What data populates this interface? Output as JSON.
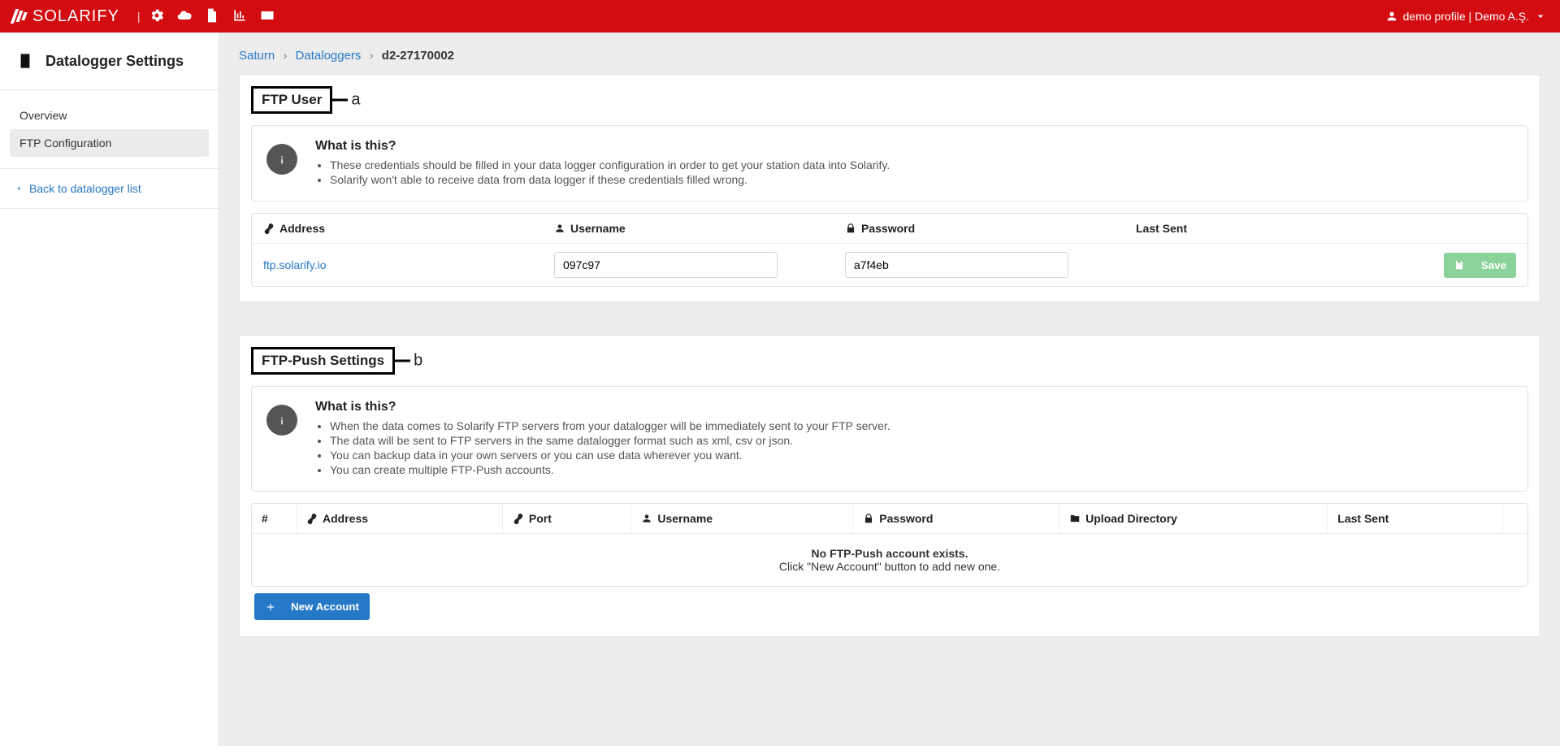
{
  "topbar": {
    "brand": "SOLARIFY",
    "profile": "demo profile | Demo A.Ş."
  },
  "sidebar": {
    "title": "Datalogger Settings",
    "items": [
      {
        "label": "Overview"
      },
      {
        "label": "FTP Configuration"
      }
    ],
    "back": "Back to datalogger list"
  },
  "breadcrumb": {
    "a": "Saturn",
    "b": "Dataloggers",
    "cur": "d2-27170002"
  },
  "ftp_user": {
    "title": "FTP User",
    "annot": "a",
    "info_title": "What is this?",
    "info_bullets": [
      "These credentials should be filled in your data logger configuration in order to get your station data into Solarify.",
      "Solarify won't able to receive data from data logger if these credentials filled wrong."
    ],
    "cols": {
      "address": "Address",
      "username": "Username",
      "password": "Password",
      "last": "Last Sent"
    },
    "row": {
      "address": "ftp.solarify.io",
      "username": "097c97",
      "password": "a7f4eb",
      "last": ""
    },
    "save": "Save"
  },
  "ftp_push": {
    "title": "FTP-Push Settings",
    "annot": "b",
    "info_title": "What is this?",
    "info_bullets": [
      "When the data comes to Solarify FTP servers from your datalogger will be immediately sent to your FTP server.",
      "The data will be sent to FTP servers in the same datalogger format such as xml, csv or json.",
      "You can backup data in your own servers or you can use data wherever you want.",
      "You can create multiple FTP-Push accounts."
    ],
    "cols": {
      "n": "#",
      "address": "Address",
      "port": "Port",
      "username": "Username",
      "password": "Password",
      "dir": "Upload Directory",
      "last": "Last Sent"
    },
    "empty1": "No FTP-Push account exists.",
    "empty2": "Click \"New Account\" button to add new one.",
    "new": "New Account"
  }
}
